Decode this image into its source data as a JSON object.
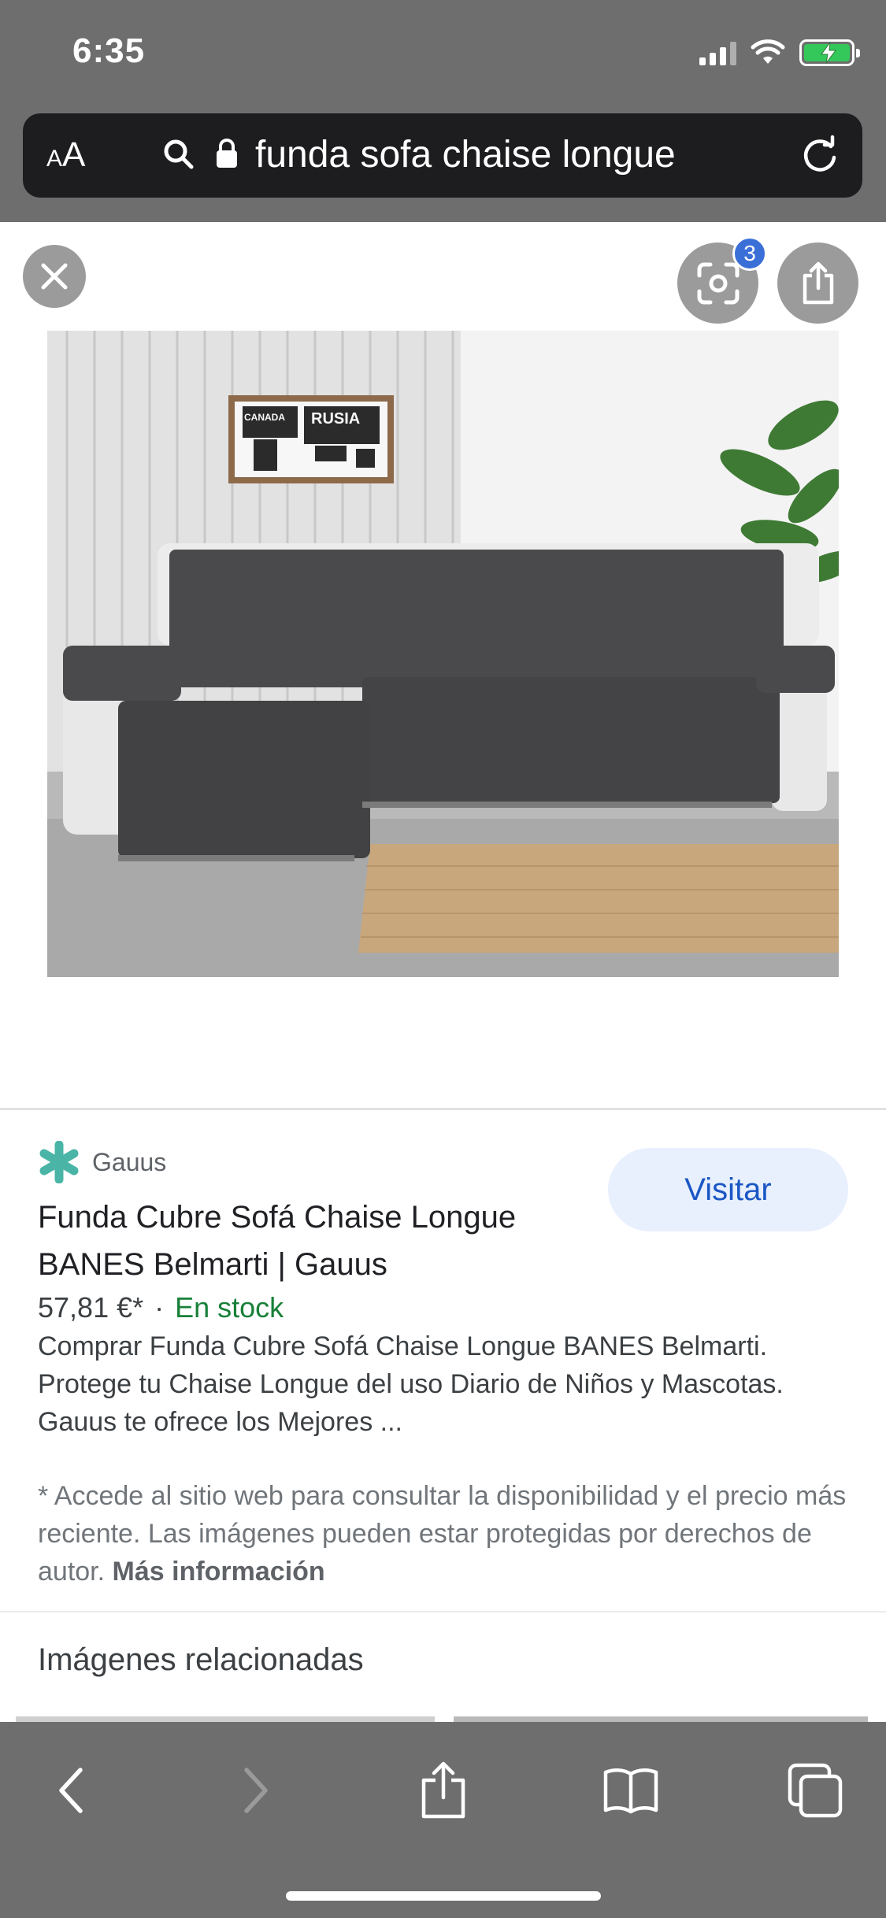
{
  "status_bar": {
    "time": "6:35"
  },
  "url_bar": {
    "text_size_label_small": "A",
    "text_size_label_large": "A",
    "address": "funda sofa chaise longue"
  },
  "viewer": {
    "lens_badge_count": "3"
  },
  "result": {
    "source_name": "Gauus",
    "visit_label": "Visitar",
    "title": "Funda Cubre Sofá Chaise Longue BANES Belmarti | Gauus",
    "price": "57,81 €*",
    "separator": "·",
    "stock": "En stock",
    "description": "Comprar Funda Cubre Sofá Chaise Longue BANES Belmarti. Protege tu Chaise Longue del uso Diario de Niños y Mascotas. Gauus te ofrece los Mejores ...",
    "disclaimer": "* Accede al sitio web para consultar la disponibilidad y el precio más reciente. Las imágenes pueden estar protegidas por derechos de autor.",
    "more_info": "Más información"
  },
  "related": {
    "title": "Imágenes relacionadas"
  },
  "image_text": {
    "map_word_1": "CANADA",
    "map_word_2": "RUSIA"
  },
  "colors": {
    "chrome_gray": "#6e6e6e",
    "url_bar_bg": "#1d1d1f",
    "visit_button_bg": "#e8f0fe",
    "visit_button_text": "#1a56c4",
    "stock_green": "#188038",
    "badge_blue": "#3b6fd8",
    "source_icon_teal": "#4ab5a6"
  },
  "icons": [
    "search-icon",
    "lock-icon",
    "reload-icon",
    "close-icon",
    "lens-icon",
    "share-icon",
    "back-icon",
    "forward-icon",
    "bookmarks-icon",
    "tabs-icon",
    "gauus-logo-icon"
  ]
}
